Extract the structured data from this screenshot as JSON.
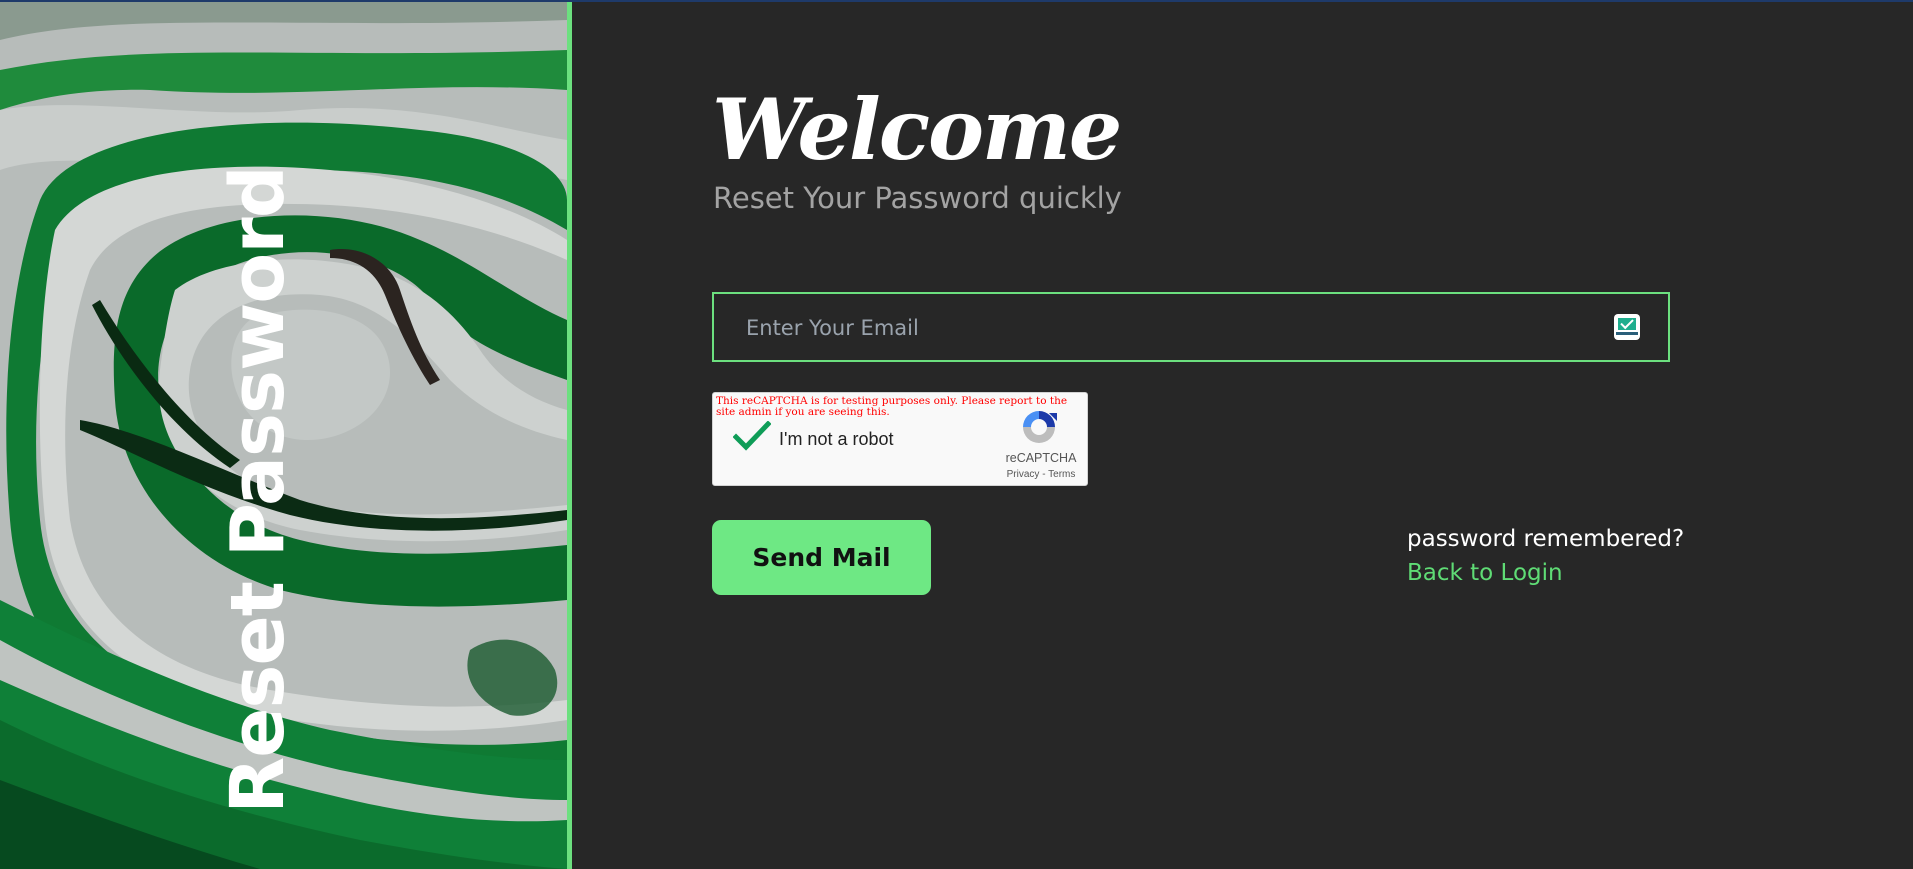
{
  "left_panel": {
    "vertical_title": "Reset Password"
  },
  "main": {
    "heading": "Welcome",
    "subtitle": "Reset Your Password quickly",
    "email": {
      "placeholder": "Enter Your Email",
      "value": "",
      "icon": "tempmail-icon"
    },
    "recaptcha": {
      "warning": "This reCAPTCHA is for testing purposes only. Please report to the site admin if you are seeing this.",
      "label": "I'm not a robot",
      "checked": true,
      "brand": "reCAPTCHA",
      "privacy": "Privacy",
      "separator": " - ",
      "terms": "Terms"
    },
    "send_button": "Send Mail",
    "remembered_text": "password remembered?",
    "back_link": "Back to Login"
  },
  "colors": {
    "accent": "#6ee884",
    "link": "#5fdc75",
    "background": "#272727",
    "subtitle": "#a3a3a3",
    "warning": "#ff0000"
  }
}
